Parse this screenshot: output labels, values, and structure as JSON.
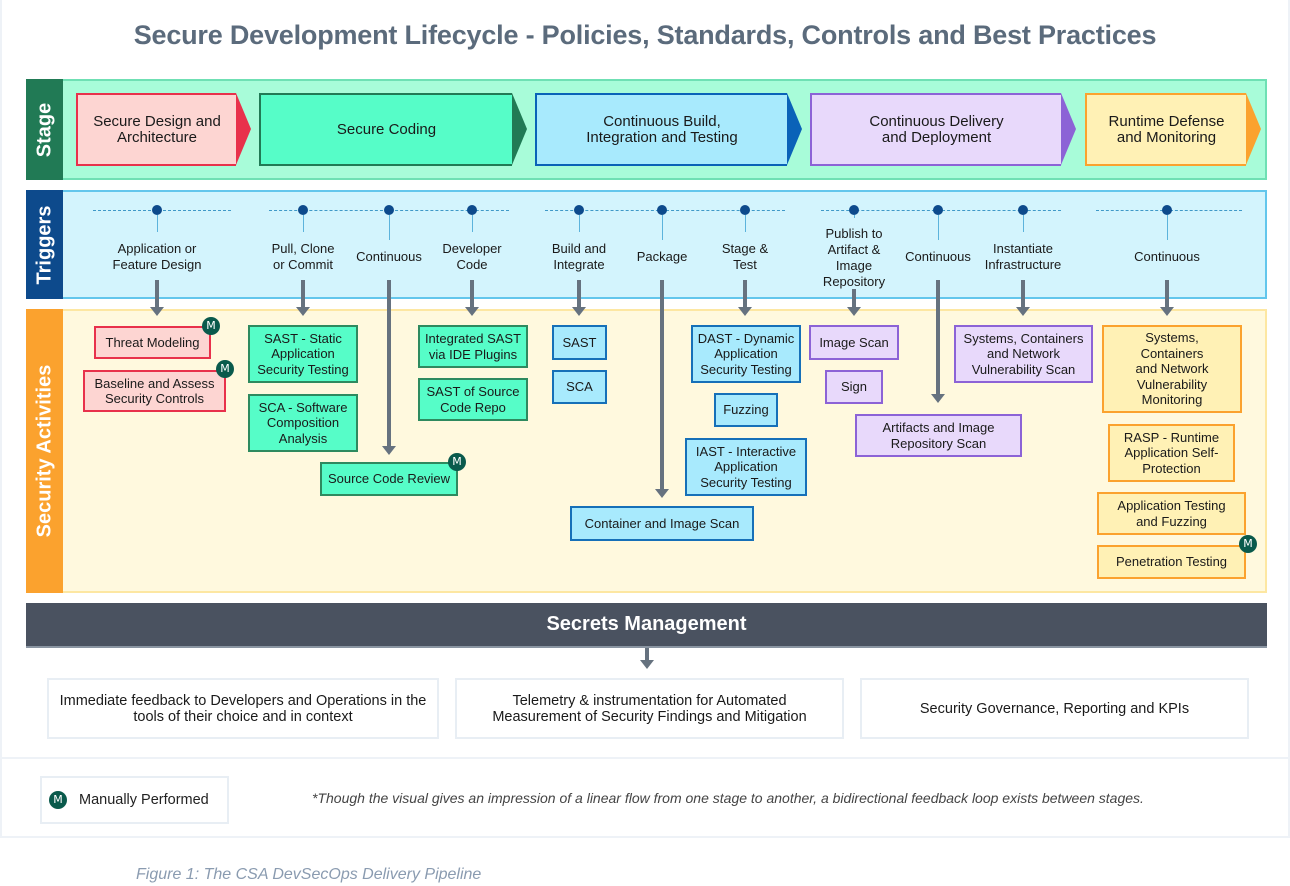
{
  "title": "Secure Development Lifecycle - Policies, Standards, Controls and Best Practices",
  "bands": {
    "stage": "Stage",
    "triggers": "Triggers",
    "activities": "Security Activities"
  },
  "stages": [
    {
      "label": "Secure Design and Architecture",
      "color": "#e8314b"
    },
    {
      "label": "Secure Coding",
      "color": "#217a55"
    },
    {
      "label": "Continuous Build, Integration and Testing",
      "color": "#0a62b8"
    },
    {
      "label": "Continuous Delivery and Deployment",
      "color": "#8c63d6"
    },
    {
      "label": "Runtime Defense and Monitoring",
      "color": "#fba22e"
    }
  ],
  "triggers": [
    {
      "label": "Application or\nFeature Design"
    },
    {
      "label": "Pull, Clone\nor Commit"
    },
    {
      "label": "Continuous"
    },
    {
      "label": "Developer\nCode"
    },
    {
      "label": "Build and\nIntegrate"
    },
    {
      "label": "Package"
    },
    {
      "label": "Stage &\nTest"
    },
    {
      "label": "Publish to\nArtifact &\nImage\nRepository"
    },
    {
      "label": "Continuous"
    },
    {
      "label": "Instantiate\nInfrastructure"
    },
    {
      "label": "Continuous"
    }
  ],
  "activities": [
    {
      "label": "Threat Modeling",
      "manual": true
    },
    {
      "label": "Baseline and Assess Security Controls",
      "manual": true
    },
    {
      "label": "SAST - Static Application Security Testing",
      "manual": false
    },
    {
      "label": "SCA - Software Composition Analysis",
      "manual": false
    },
    {
      "label": "Source Code Review",
      "manual": true
    },
    {
      "label": "Integrated SAST via IDE Plugins",
      "manual": false
    },
    {
      "label": "SAST of Source Code Repo",
      "manual": false
    },
    {
      "label": "SAST",
      "manual": false
    },
    {
      "label": "SCA",
      "manual": false
    },
    {
      "label": "Container and Image Scan",
      "manual": false
    },
    {
      "label": "DAST - Dynamic Application Security Testing",
      "manual": false
    },
    {
      "label": "Fuzzing",
      "manual": false
    },
    {
      "label": "IAST - Interactive Application Security Testing",
      "manual": false
    },
    {
      "label": "Image Scan",
      "manual": false
    },
    {
      "label": "Sign",
      "manual": false
    },
    {
      "label": "Artifacts and Image Repository Scan",
      "manual": false
    },
    {
      "label": "Systems, Containers and Network Vulnerability Scan",
      "manual": false
    },
    {
      "label": "Systems, Containers and Network Vulnerability Monitoring",
      "manual": false
    },
    {
      "label": "RASP - Runtime Application Self-Protection",
      "manual": false
    },
    {
      "label": "Application Testing and Fuzzing",
      "manual": false
    },
    {
      "label": "Penetration Testing",
      "manual": true
    }
  ],
  "secrets": "Secrets Management",
  "outcomes": [
    "Immediate feedback to Developers and Operations in the tools of their choice and in context",
    "Telemetry & instrumentation for Automated Measurement of Security Findings and Mitigation",
    "Security Governance, Reporting and KPIs"
  ],
  "legend": {
    "badge": "M",
    "label": "Manually Performed"
  },
  "note": "*Though the visual gives an impression of a linear flow from one stage to another, a bidirectional feedback loop exists between stages.",
  "caption": "Figure 1: The CSA DevSecOps Delivery Pipeline"
}
